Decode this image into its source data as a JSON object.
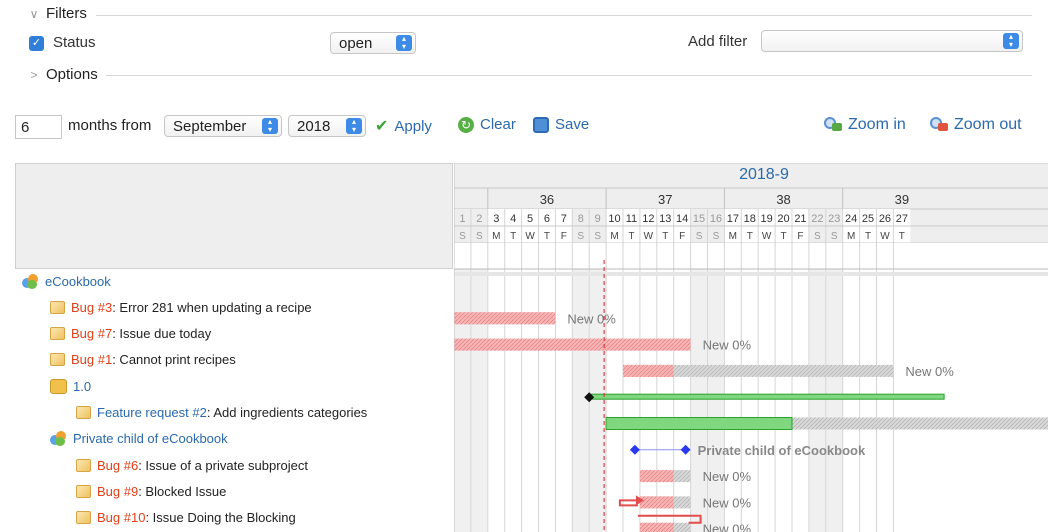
{
  "filters": {
    "legend": "Filters",
    "status_label": "Status",
    "status_value": "open",
    "add_filter_label": "Add filter",
    "add_filter_value": ""
  },
  "options": {
    "legend": "Options"
  },
  "toolbar": {
    "months": "6",
    "months_from_label": "months from",
    "month": "September",
    "year": "2018",
    "apply": "Apply",
    "clear": "Clear",
    "save": "Save",
    "zoom_in": "Zoom in",
    "zoom_out": "Zoom out"
  },
  "gantt": {
    "month_label": "2018-9",
    "weeks": [
      {
        "label": "36",
        "start": 3,
        "end": 9
      },
      {
        "label": "37",
        "start": 10,
        "end": 16
      },
      {
        "label": "38",
        "start": 17,
        "end": 23
      },
      {
        "label": "39",
        "start": 24,
        "end": 30
      }
    ],
    "days": [
      {
        "n": "1",
        "w": "S"
      },
      {
        "n": "2",
        "w": "S"
      },
      {
        "n": "3",
        "w": "M"
      },
      {
        "n": "4",
        "w": "T"
      },
      {
        "n": "5",
        "w": "W"
      },
      {
        "n": "6",
        "w": "T"
      },
      {
        "n": "7",
        "w": "F"
      },
      {
        "n": "8",
        "w": "S"
      },
      {
        "n": "9",
        "w": "S"
      },
      {
        "n": "10",
        "w": "M"
      },
      {
        "n": "11",
        "w": "T"
      },
      {
        "n": "12",
        "w": "W"
      },
      {
        "n": "13",
        "w": "T"
      },
      {
        "n": "14",
        "w": "F"
      },
      {
        "n": "15",
        "w": "S"
      },
      {
        "n": "16",
        "w": "S"
      },
      {
        "n": "17",
        "w": "M"
      },
      {
        "n": "18",
        "w": "T"
      },
      {
        "n": "19",
        "w": "W"
      },
      {
        "n": "20",
        "w": "T"
      },
      {
        "n": "21",
        "w": "F"
      },
      {
        "n": "22",
        "w": "S"
      },
      {
        "n": "23",
        "w": "S"
      },
      {
        "n": "24",
        "w": "M"
      },
      {
        "n": "25",
        "w": "T"
      },
      {
        "n": "26",
        "w": "W"
      },
      {
        "n": "27",
        "w": "T"
      }
    ],
    "today": 9,
    "rows": [
      {
        "kind": "project",
        "tracker": "",
        "title": "eCookbook",
        "level": 0
      },
      {
        "kind": "issue",
        "tracker": "Bug #3",
        "title": ": Error 281 when updating a recipe",
        "level": 1,
        "bar": {
          "start": 1,
          "end": 6,
          "done": 6
        },
        "label": "New 0%"
      },
      {
        "kind": "issue",
        "tracker": "Bug #7",
        "title": ": Issue due today",
        "level": 1,
        "bar": {
          "start": 1,
          "end": 14,
          "done": 14
        },
        "label": "New 0%"
      },
      {
        "kind": "issue",
        "tracker": "Bug #1",
        "title": ": Cannot print recipes",
        "level": 1,
        "bar": {
          "start": 11,
          "end": 26,
          "done": 13
        },
        "label": "New 0%"
      },
      {
        "kind": "version",
        "tracker": "",
        "title": "1.0",
        "level": 1,
        "line": {
          "start": 9,
          "end": 30
        }
      },
      {
        "kind": "feature",
        "tracker": "Feature request #2",
        "title": ": Add ingredients categories",
        "level": 2,
        "bar": {
          "start": 10,
          "end": 40,
          "done": 20
        },
        "label": ""
      },
      {
        "kind": "subproject",
        "tracker": "",
        "title": "Private child of eCookbook",
        "level": 1,
        "diamonds": {
          "start": 12,
          "end": 15
        },
        "label": "Private child of eCookbook"
      },
      {
        "kind": "issue",
        "tracker": "Bug #6",
        "title": ": Issue of a private subproject",
        "level": 2,
        "bar": {
          "start": 12,
          "end": 14,
          "done": 13
        },
        "label": "New 0%"
      },
      {
        "kind": "issue",
        "tracker": "Bug #9",
        "title": ": Blocked Issue",
        "level": 2,
        "bar": {
          "start": 12,
          "end": 14,
          "done": 13
        },
        "label": "New 0%"
      },
      {
        "kind": "issue",
        "tracker": "Bug #10",
        "title": ": Issue Doing the Blocking",
        "level": 2,
        "bar": {
          "start": 12,
          "end": 14,
          "done": 13
        },
        "label": "New 0%"
      }
    ]
  },
  "colors": {
    "late": "#f3a5a5",
    "late_border": "#e44c4c",
    "todo": "#d5d5d5",
    "version": "#7fd87f",
    "version_border": "#2ba12b",
    "diamond": "#2a39f0",
    "today": "#e02020",
    "weekend": "#f0f0f0"
  }
}
